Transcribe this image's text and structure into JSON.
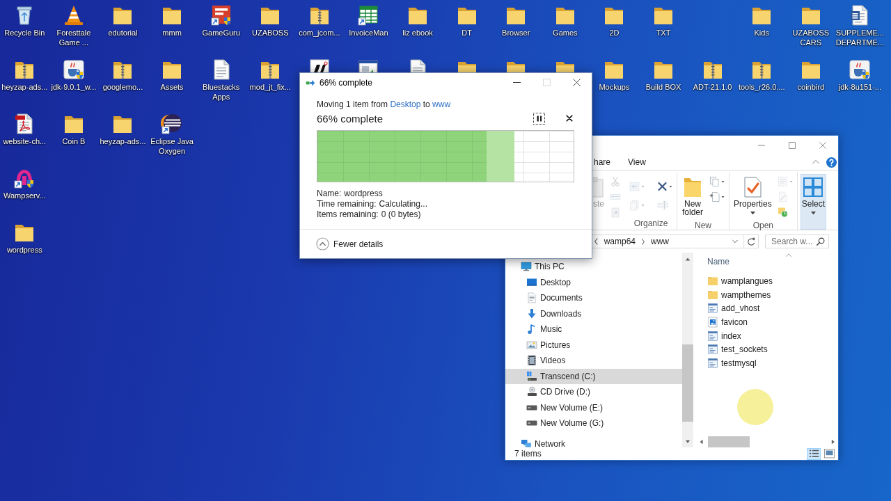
{
  "desktop": {
    "rows": [
      [
        {
          "label": "Recycle Bin",
          "kind": "recycle-bin"
        },
        {
          "label": "Foresttale Game ...",
          "kind": "cone"
        },
        {
          "label": "edutorial",
          "kind": "folder"
        },
        {
          "label": "mmm",
          "kind": "folder"
        },
        {
          "label": "GameGuru",
          "kind": "app-tile"
        },
        {
          "label": "UZABOSS",
          "kind": "folder"
        },
        {
          "label": "com_jcom...",
          "kind": "zip"
        },
        {
          "label": "InvoiceMan",
          "kind": "sheet"
        },
        {
          "label": "liz ebook",
          "kind": "folder"
        },
        {
          "label": "DT",
          "kind": "folder"
        },
        {
          "label": "Browser",
          "kind": "folder"
        },
        {
          "label": "Games",
          "kind": "folder"
        },
        {
          "label": "2D",
          "kind": "folder"
        },
        {
          "label": "TXT",
          "kind": "folder"
        },
        "",
        {
          "label": "Kids",
          "kind": "folder"
        },
        {
          "label": "UZABOSS CARS",
          "kind": "folder"
        },
        {
          "label": "SUPPLEME... DEPARTME...",
          "kind": "word"
        }
      ],
      [
        {
          "label": "heyzap-ads...",
          "kind": "zip"
        },
        {
          "label": "jdk-9.0.1_w...",
          "kind": "java"
        },
        {
          "label": "googlemo...",
          "kind": "zip"
        },
        {
          "label": "Assets",
          "kind": "folder"
        },
        {
          "label": "Bluestacks Apps",
          "kind": "doc"
        },
        {
          "label": "mod_jt_fix...",
          "kind": "zip"
        },
        {
          "kind": "logo-tile"
        },
        {
          "kind": "window-app"
        },
        {
          "kind": "doc"
        },
        {
          "kind": "folder"
        },
        {
          "kind": "folder"
        },
        {
          "kind": "folder"
        },
        {
          "label": "Mockups",
          "kind": "folder"
        },
        {
          "label": "Build BOX",
          "kind": "folder"
        },
        {
          "label": "ADT-21.1.0",
          "kind": "zip"
        },
        {
          "label": "tools_r26.0....",
          "kind": "zip"
        },
        {
          "label": "coinbird",
          "kind": "folder"
        },
        {
          "label": "jdk-8u151-...",
          "kind": "java"
        }
      ],
      [
        {
          "label": "website-ch...",
          "kind": "pdf"
        },
        {
          "label": "Coin B",
          "kind": "folder"
        },
        {
          "label": "heyzap-ads...",
          "kind": "folder"
        },
        {
          "label": "Eclipse Java Oxygen",
          "kind": "eclipse"
        }
      ],
      [
        {
          "label": "Wampserv...",
          "kind": "wamp"
        }
      ],
      [
        {
          "label": "wordpress",
          "kind": "folder"
        }
      ]
    ]
  },
  "copy_dialog": {
    "title": "66% complete",
    "window_buttons": [
      {
        "kind": "minimize",
        "disabled": false
      },
      {
        "kind": "maximize",
        "disabled": true
      },
      {
        "kind": "close",
        "disabled": false
      }
    ],
    "summary": {
      "prefix": "Moving 1 item from",
      "source": "Desktop",
      "joiner": "to",
      "destination": "www"
    },
    "heading": "66% complete",
    "controls": [
      {
        "kind": "pause",
        "focused": true
      },
      {
        "kind": "cancel",
        "focused": false
      }
    ],
    "progress": {
      "level": 0.66
    },
    "details": [
      {
        "label": "Name:",
        "value": "wordpress"
      },
      {
        "label": "Time remaining:",
        "value": "Calculating..."
      },
      {
        "label": "Items remaining:",
        "value": "0 (0 bytes)"
      }
    ],
    "toggle": {
      "label": "Fewer details",
      "expanded": true
    }
  },
  "explorer": {
    "window_buttons": [
      {
        "kind": "minimize",
        "disabled": false
      },
      {
        "kind": "maximize",
        "disabled": false
      },
      {
        "kind": "close",
        "disabled": false
      }
    ],
    "ribbon_tabs": [
      {
        "label": "hare",
        "selected": false
      },
      {
        "label": "View",
        "selected": false
      }
    ],
    "ribbon_groups": [
      {
        "buttons": [
          {
            "kind": "paste",
            "label": "ste",
            "disabled": true,
            "highlighted": false,
            "menu": false
          }
        ],
        "small": [
          {
            "kind": "cut",
            "disabled": true
          },
          {
            "kind": "copy-path",
            "disabled": true
          },
          {
            "kind": "paste-shortcut",
            "disabled": true
          }
        ]
      },
      {
        "label": "Organize",
        "small": [
          {
            "kind": "move-to",
            "disabled": true
          },
          {
            "kind": "copy-to",
            "disabled": true
          },
          {
            "kind": "delete",
            "disabled": false
          },
          {
            "kind": "rename",
            "disabled": true
          }
        ]
      },
      {
        "label": "New",
        "buttons": [
          {
            "kind": "new-folder",
            "label": "New folder",
            "disabled": false,
            "highlighted": false,
            "menu": false
          }
        ],
        "small": [
          {
            "kind": "new-item",
            "disabled": false
          },
          {
            "kind": "easy-access",
            "disabled": false
          }
        ]
      },
      {
        "label": "Open",
        "buttons": [
          {
            "kind": "properties",
            "label": "Properties",
            "disabled": false,
            "highlighted": false,
            "menu": true
          }
        ],
        "small": [
          {
            "kind": "open",
            "disabled": true
          },
          {
            "kind": "edit",
            "disabled": true
          },
          {
            "kind": "history",
            "disabled": false
          }
        ]
      },
      {
        "buttons": [
          {
            "kind": "select",
            "label": "Select",
            "disabled": false,
            "highlighted": true,
            "menu": true
          }
        ]
      }
    ],
    "address": {
      "path": [
        "wamp64",
        "www"
      ]
    },
    "search": {
      "placeholder": "Search w..."
    },
    "nav_tree": [
      {
        "label": "This PC",
        "kind": "pc",
        "selected": false,
        "children": [
          {
            "label": "Desktop",
            "kind": "desktop",
            "selected": false
          },
          {
            "label": "Documents",
            "kind": "documents",
            "selected": false
          },
          {
            "label": "Downloads",
            "kind": "downloads",
            "selected": false
          },
          {
            "label": "Music",
            "kind": "music",
            "selected": false
          },
          {
            "label": "Pictures",
            "kind": "pictures",
            "selected": false
          },
          {
            "label": "Videos",
            "kind": "videos",
            "selected": false
          },
          {
            "label": "Transcend (C:)",
            "kind": "system-drive",
            "selected": true
          },
          {
            "label": "CD Drive (D:)",
            "kind": "cd-drive",
            "selected": false
          },
          {
            "label": "New Volume (E:)",
            "kind": "drive",
            "selected": false
          },
          {
            "label": "New Volume (G:)",
            "kind": "drive",
            "selected": false
          }
        ]
      },
      {
        "label": "Network",
        "kind": "network",
        "selected": false
      }
    ],
    "column_header": "Name",
    "files": [
      {
        "name": "wamplangues",
        "kind": "folder"
      },
      {
        "name": "wampthemes",
        "kind": "folder"
      },
      {
        "name": "add_vhost",
        "kind": "script"
      },
      {
        "name": "favicon",
        "kind": "image"
      },
      {
        "name": "index",
        "kind": "script"
      },
      {
        "name": "test_sockets",
        "kind": "script"
      },
      {
        "name": "testmysql",
        "kind": "script"
      }
    ],
    "status": "7 items",
    "view_buttons": [
      {
        "kind": "details",
        "selected": true
      },
      {
        "kind": "large-icons",
        "selected": false
      }
    ]
  }
}
